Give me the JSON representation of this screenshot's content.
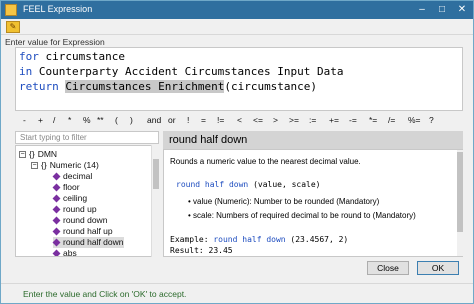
{
  "window": {
    "title": "FEEL Expression"
  },
  "editor": {
    "instruction": "Enter value for Expression",
    "line1": {
      "kw": "for",
      "rest": " circumstance"
    },
    "line2": {
      "kw": "in",
      "rest": " Counterparty Accident Circumstances Input Data"
    },
    "line3": {
      "kw": "return",
      "sp": " ",
      "hl": "Circumstances Enrichment",
      "rest": "(circumstance)"
    }
  },
  "operators": [
    "-",
    "+",
    "/",
    "*",
    "%",
    "**",
    "(",
    ")",
    "and",
    "or",
    "!",
    "=",
    "!=",
    "<",
    "<=",
    ">",
    ">=",
    ":=",
    "+=",
    "-=",
    "*=",
    "/=",
    "%=",
    "?"
  ],
  "filter": {
    "placeholder": "Start typing to filter"
  },
  "tree": {
    "root": "DMN",
    "group": "Numeric (14)",
    "items": [
      "decimal",
      "floor",
      "ceiling",
      "round up",
      "round down",
      "round half up",
      "round half down",
      "abs"
    ]
  },
  "info": {
    "heading": "round half down",
    "description": "Rounds a numeric value to the nearest decimal value.",
    "signature_fn": "round half down",
    "signature_args": " (value, scale)",
    "params": [
      "value (Numeric): Number to be rounded (Mandatory)",
      "scale: Numbers of required decimal to be round to (Mandatory)"
    ],
    "example_label": "Example: ",
    "example_fn": "round half down",
    "example_args": " (23.4567, 2)",
    "result": "Result: 23.45"
  },
  "buttons": {
    "close": "Close",
    "ok": "OK"
  },
  "status": "Enter the value and Click on 'OK' to accept.",
  "colors": {
    "titlebar": "#2f6f9f",
    "keyword": "#1d4cbf",
    "status_text": "#2b6a2b"
  }
}
